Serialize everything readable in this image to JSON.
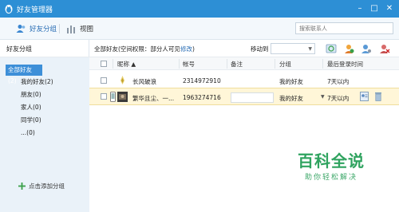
{
  "window": {
    "title": "好友管理器"
  },
  "toolbar": {
    "friend_group_label": "好友分组",
    "view_label": "视图",
    "search_placeholder": "搜索联系人"
  },
  "sidebar": {
    "title": "好友分组",
    "groups": [
      {
        "label": "全部好友(2)"
      },
      {
        "label": "我的好友(2)"
      },
      {
        "label": "朋友(0)"
      },
      {
        "label": "家人(0)"
      },
      {
        "label": "同学(0)"
      },
      {
        "label": "...(0)"
      }
    ],
    "add_group_label": "点击添加分组"
  },
  "main": {
    "perm_text": "全部好友(空间权限：部分人可见",
    "perm_link": "修改",
    "perm_close": ")",
    "move_to_label": "移动到",
    "columns": {
      "nickname": "昵称 ▲",
      "account": "帐号",
      "note": "备注",
      "group": "分组",
      "last_login": "最后登录时间"
    },
    "rows": [
      {
        "nickname": "长风破浪",
        "account": "2314972910",
        "note": "",
        "group": "我的好友",
        "last_login": "7天以内"
      },
      {
        "nickname": "繁华且尘、一...",
        "account": "1963274716",
        "note": "",
        "group": "我的好友",
        "last_login": "7天以内"
      }
    ]
  },
  "watermark": {
    "title": "百科全说",
    "subtitle": "助你轻松解决"
  },
  "colors": {
    "titlebar": "#2d8fd5",
    "accent": "#2a6eb5",
    "selected_row": "#fff6d8",
    "watermark": "#2fa35f"
  }
}
